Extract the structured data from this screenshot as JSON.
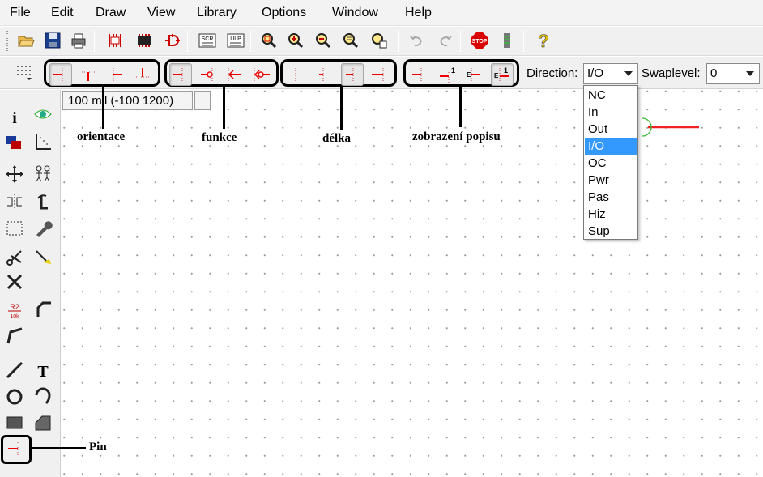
{
  "menu": [
    "File",
    "Edit",
    "Draw",
    "View",
    "Library",
    "Options",
    "Window",
    "Help"
  ],
  "toolbar1_icons": [
    "open-icon",
    "save-icon",
    "print-icon",
    "schematic-board-switch-icon",
    "use-icon",
    "cam-icon",
    "script-icon",
    "ulp-icon",
    "zoom-fit-icon",
    "zoom-in-icon",
    "zoom-out-icon",
    "zoom-redraw-icon",
    "zoom-select-icon",
    "undo-icon",
    "redo-icon",
    "stop-icon",
    "go-icon",
    "help-icon"
  ],
  "toolbar1_labels": {
    "script": "SCR",
    "ulp": "ULP",
    "stop": "STOP",
    "help": "?"
  },
  "toolbar2": {
    "direction_label": "Direction:",
    "direction_value": "I/O",
    "swaplevel_label": "Swaplevel:",
    "swaplevel_value": "0",
    "visible_label_letter": "E",
    "visible_label_number": "1"
  },
  "direction_options": [
    "NC",
    "In",
    "Out",
    "I/O",
    "OC",
    "Pwr",
    "Pas",
    "Hiz",
    "Sup"
  ],
  "direction_selected": "I/O",
  "coordinate": "100 mil (-100 1200)",
  "left_tool_labels": {
    "info": "i",
    "value": "R2",
    "value_sub": "10k",
    "text": "T"
  },
  "annotations": {
    "orientace": "orientace",
    "funkce": "funkce",
    "delka": "délka",
    "zobrazeni": "zobrazení popisu",
    "pin": "Pin"
  },
  "colors": {
    "pin_red": "#e00000",
    "accent_green": "#33bb33",
    "selection_blue": "#3399ff"
  }
}
